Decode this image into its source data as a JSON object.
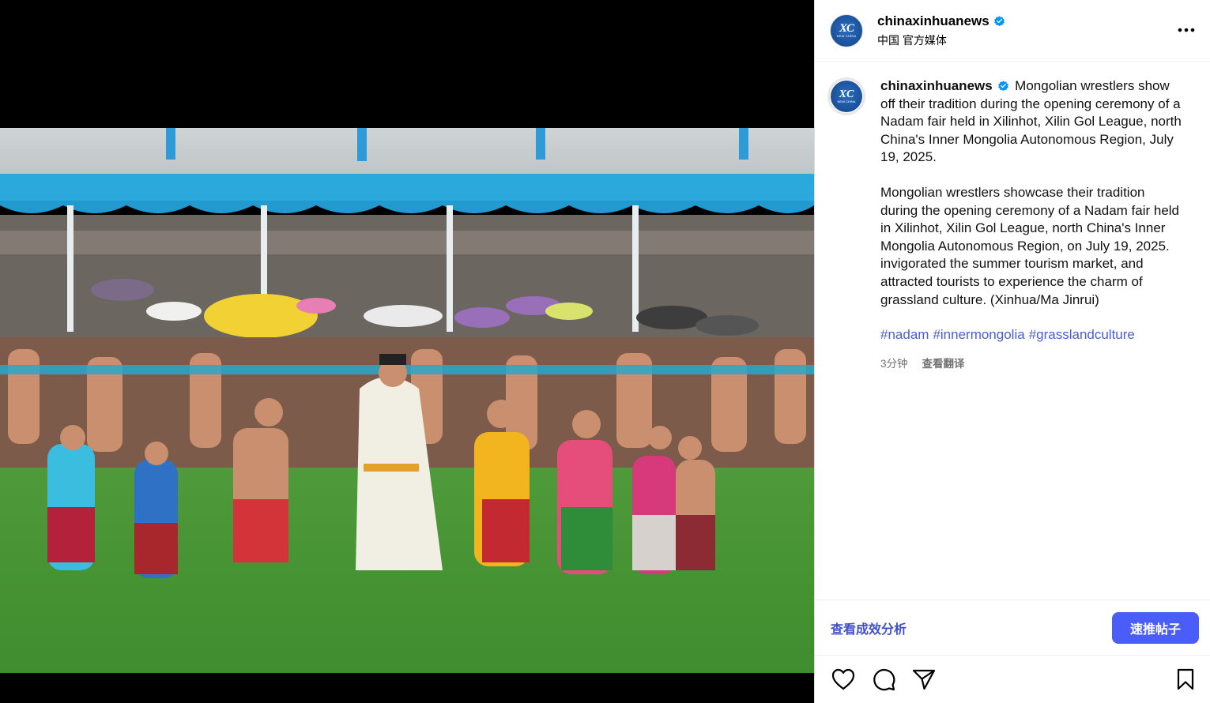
{
  "account": {
    "username": "chinaxinhuanews",
    "subtitle": "中国 官方媒体",
    "avatar_monogram": "XC",
    "avatar_mini_text": "NEW CHINA"
  },
  "caption": {
    "username": "chinaxinhuanews",
    "paragraph1": "Mongolian wrestlers show off their tradition during the opening ceremony of a Nadam fair held in Xilinhot, Xilin Gol League, north China's Inner Mongolia Autonomous Region, July 19, 2025.",
    "paragraph2": "Mongolian wrestlers showcase their tradition during the opening ceremony of a Nadam fair held in Xilinhot, Xilin Gol League, north China's Inner Mongolia Autonomous Region, on July 19, 2025. invigorated the summer tourism market, and attracted tourists to experience the charm of grassland culture. (Xinhua/Ma Jinrui)",
    "hashtags": [
      "#nadam",
      "#innermongolia",
      "#grasslandculture"
    ],
    "time_ago": "3分钟",
    "translate_label": "查看翻译"
  },
  "promo": {
    "insights_label": "查看成效分析",
    "boost_label": "速推帖子"
  },
  "actions": {
    "like_icon": "heart-icon",
    "comment_icon": "comment-icon",
    "share_icon": "share-icon",
    "save_icon": "bookmark-icon"
  },
  "colors": {
    "link_blue": "#4a5dd9",
    "boost_button": "#4a5df9",
    "verified_badge": "#0095f6"
  }
}
